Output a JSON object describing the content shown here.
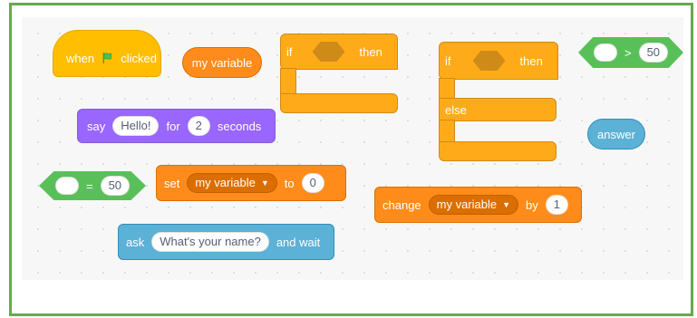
{
  "blocks": {
    "when_flag": {
      "pre": "when",
      "post": "clicked"
    },
    "my_variable": {
      "label": "my variable"
    },
    "if_then_1": {
      "if": "if",
      "then": "then"
    },
    "if_else": {
      "if": "if",
      "then": "then",
      "else": "else"
    },
    "gt": {
      "op": ">",
      "value": "50"
    },
    "say_for": {
      "say": "say",
      "message": "Hello!",
      "for": "for",
      "secs": "2",
      "seconds": "seconds"
    },
    "answer": {
      "label": "answer"
    },
    "eq": {
      "op": "=",
      "value": "50"
    },
    "set_var": {
      "set": "set",
      "variable": "my variable",
      "to": "to",
      "value": "0"
    },
    "change_var": {
      "change": "change",
      "variable": "my variable",
      "by": "by",
      "value": "1"
    },
    "ask_wait": {
      "ask": "ask",
      "question": "What's your name?",
      "and_wait": "and wait"
    }
  },
  "colors": {
    "events": "#ffbf00",
    "looks": "#9966ff",
    "data": "#ff8c1a",
    "control": "#ffab19",
    "sensing": "#5cb1d6",
    "operators": "#59c059",
    "frame_border": "#6aa84f",
    "flag": "#4cbf56"
  },
  "icons": {
    "green_flag": "green-flag-icon",
    "dropdown": "dropdown-caret-icon"
  }
}
